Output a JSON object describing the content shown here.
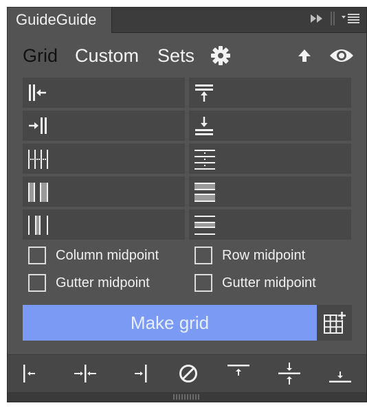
{
  "panel": {
    "title": "GuideGuide"
  },
  "nav": {
    "tabs": [
      "Grid",
      "Custom",
      "Sets"
    ]
  },
  "options": {
    "column_midpoint": "Column midpoint",
    "row_midpoint": "Row midpoint",
    "col_gutter_midpoint": "Gutter midpoint",
    "row_gutter_midpoint": "Gutter midpoint"
  },
  "actions": {
    "make_grid": "Make grid"
  },
  "colors": {
    "accent": "#7a9af4",
    "panel": "#535353",
    "field": "#474747",
    "header": "#3c3c3c",
    "text": "#f0f0f0"
  },
  "icons": {
    "titlebar": [
      "fast-forward-icon",
      "panel-menu-icon"
    ],
    "nav": [
      "gear-icon",
      "arrow-up-icon",
      "eye-icon"
    ],
    "fields_left": [
      "left-margin-icon",
      "right-margin-icon",
      "columns-icon",
      "column-width-icon",
      "column-gutter-icon"
    ],
    "fields_right": [
      "top-margin-icon",
      "bottom-margin-icon",
      "rows-icon",
      "row-height-icon",
      "row-gutter-icon"
    ],
    "make": "add-grid-icon",
    "footer": [
      "guide-left-icon",
      "guide-center-vertical-icon",
      "guide-right-icon",
      "clear-guides-icon",
      "guide-top-icon",
      "guide-center-horizontal-icon",
      "guide-bottom-icon"
    ]
  }
}
